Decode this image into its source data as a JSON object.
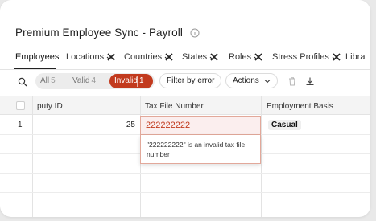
{
  "page": {
    "title": "Premium Employee Sync - Payroll"
  },
  "tabs": [
    {
      "label": "Employees",
      "active": true,
      "error": false
    },
    {
      "label": "Locations",
      "error": true
    },
    {
      "label": "Countries",
      "error": true
    },
    {
      "label": "States",
      "error": true
    },
    {
      "label": "Roles",
      "error": true
    },
    {
      "label": "Stress Profiles",
      "error": true
    },
    {
      "label": "Libra",
      "error": false
    }
  ],
  "filters": {
    "all": {
      "label": "All",
      "count": "5"
    },
    "valid": {
      "label": "Valid",
      "count": "4"
    },
    "invalid": {
      "label": "Invalid",
      "count": "1"
    }
  },
  "toolbar": {
    "filter_by_error": "Filter by error",
    "actions": "Actions"
  },
  "columns": [
    "puty ID",
    "Tax File Number",
    "Employment Basis"
  ],
  "rows": [
    {
      "index": "1",
      "id": "25",
      "tfn": "222222222",
      "basis": "Casual"
    }
  ],
  "error": {
    "message": "\"222222222\" is an invalid tax file number"
  },
  "colors": {
    "accent_error": "#c23a1e",
    "error_bg": "#fbeeee"
  }
}
